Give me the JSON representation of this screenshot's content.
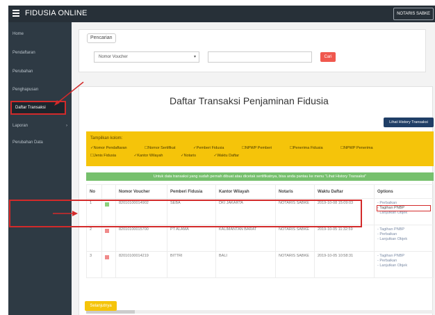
{
  "app": {
    "title": "FIDUSIA ONLINE",
    "user": "NOTARIS SABKE"
  },
  "sidebar": {
    "items": [
      {
        "label": "Home"
      },
      {
        "label": "Pendaftaran"
      },
      {
        "label": "Perubahan"
      },
      {
        "label": "Penghapusan"
      },
      {
        "label": "Daftar Transaksi"
      },
      {
        "label": "Laporan",
        "arrow": "›"
      },
      {
        "label": "Perubahan Data"
      }
    ]
  },
  "search": {
    "legend": "Pencarian",
    "select_value": "Nomor Voucher",
    "input_value": "",
    "button": "Cari"
  },
  "page": {
    "title": "Daftar Transaksi Penjaminan Fidusia",
    "history_button": "Lihat History Transaksi"
  },
  "filters": {
    "title": "Tampilkan kolom:",
    "options_row1": [
      "Nomor Pendaftaran",
      "Nomor Sertifikat",
      "Pemberi Fidusia",
      "NPWP Pemberi",
      "Penerima Fidusia",
      "NPWP Penerima"
    ],
    "options_row2": [
      "Jenis Fidusia",
      "Kantor Wilayah",
      "Notaris",
      "Waktu Daftar"
    ]
  },
  "notice": "Untuk data transaksi yang sudah pernah dibuat atau dicetak sertifikatnya, bisa anda pantau ke menu \"Lihat History Transaksi\"",
  "table": {
    "headers": [
      "No",
      "",
      "Nomor Voucher",
      "Pemberi Fidusia",
      "Kantor Wilayah",
      "Notaris",
      "Waktu Daftar",
      "Options"
    ],
    "rows": [
      {
        "no": "1",
        "status": "#8bd17c",
        "voucher": "82010100014902",
        "pemberi": "SEBA",
        "kantor": "DKI JAKARTA",
        "notaris": "NOTARIS SABKE",
        "waktu": "2019-10-08 15:09:03",
        "options": [
          "- Perbaikan",
          "- Tagihan PNBP",
          "- Lanjutkan Objek"
        ]
      },
      {
        "no": "2",
        "status": "#f08a8a",
        "voucher": "82010100015700",
        "pemberi": "PT ALAMA",
        "kantor": "KALIMANTAN BARAT",
        "notaris": "NOTARIS SABKE",
        "waktu": "2019-10-05 11:32:59",
        "options": [
          "- Tagihan PNBP",
          "- Perbaikan",
          "- Lanjutkan Objek"
        ]
      },
      {
        "no": "3",
        "status": "#f08a8a",
        "voucher": "82010100014219",
        "pemberi": "BITTRI",
        "kantor": "BALI",
        "notaris": "NOTARIS SABKE",
        "waktu": "2019-10-05 10:58:31",
        "options": [
          "- Tagihan PNBP",
          "- Perbaikan",
          "- Lanjutkan Objek"
        ]
      }
    ]
  },
  "footer": {
    "button": "Selanjutnya"
  }
}
